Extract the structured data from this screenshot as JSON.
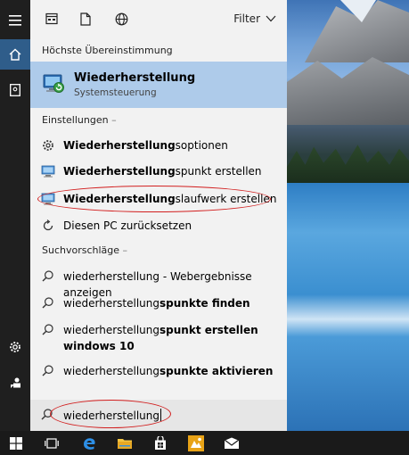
{
  "toolbar": {
    "filter_label": "Filter",
    "icons": [
      "apps-icon",
      "documents-icon",
      "web-icon",
      "chevron-down-icon"
    ]
  },
  "rail": {
    "icons": [
      "hamburger-menu-icon",
      "home-icon",
      "notebook-icon",
      "settings-icon",
      "feedback-icon"
    ]
  },
  "best_match": {
    "section_label": "Höchste Übereinstimmung",
    "title": "Wiederherstellung",
    "subtitle": "Systemsteuerung"
  },
  "settings": {
    "section_label": "Einstellungen",
    "items": [
      {
        "bold": "Wiederherstellung",
        "rest": "soptionen"
      },
      {
        "bold": "Wiederherstellung",
        "rest": "spunkt erstellen"
      },
      {
        "bold": "Wiederherstellung",
        "rest": "slaufwerk erstellen"
      },
      {
        "bold": "",
        "rest": "Diesen PC zurücksetzen"
      }
    ]
  },
  "suggestions": {
    "section_label": "Suchvorschläge",
    "items": [
      {
        "plain": "wiederherstellung",
        "bold": "",
        "hint": " - Webergebnisse anzeigen"
      },
      {
        "plain": "wiederherstellung",
        "bold": "spunkte finden",
        "hint": ""
      },
      {
        "plain": "wiederherstellung",
        "bold": "spunkt erstellen windows 10",
        "hint": ""
      },
      {
        "plain": "wiederherstellung",
        "bold": "spunkte aktivieren",
        "hint": ""
      }
    ]
  },
  "search": {
    "value": "wiederherstellung"
  },
  "taskbar": {
    "icons": [
      "windows-start-icon",
      "task-view-icon",
      "edge-browser-icon",
      "file-explorer-icon",
      "store-icon",
      "photos-app-icon",
      "mail-icon"
    ]
  },
  "colors": {
    "accent_highlight": "#aecbea",
    "rail_bg": "#1f1f1f",
    "panel_bg": "#f2f2f2",
    "annotation": "#d21f1f"
  }
}
